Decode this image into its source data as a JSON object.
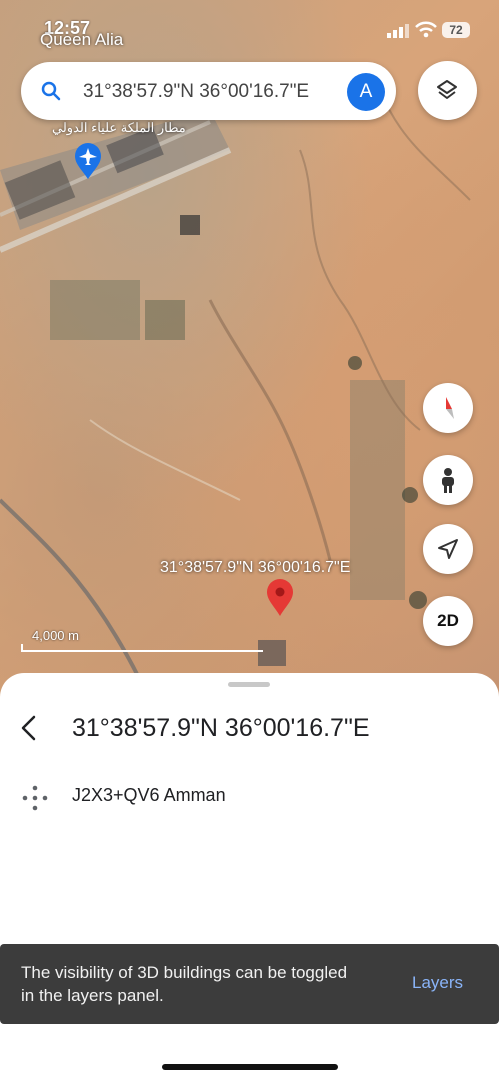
{
  "status_bar": {
    "time": "12:57",
    "battery": "72"
  },
  "map": {
    "place_labels": {
      "queen_alia": "Queen Alia",
      "arabic_airport": "مطار الملكة علياء الدولي"
    },
    "coordinate_label": "31°38'57.9\"N 36°00'16.7\"E",
    "scale_label": "4,000 m",
    "mode_button": "2D",
    "colors": {
      "pin_red": "#e53935",
      "airport_pin_blue": "#1a73e8"
    }
  },
  "search": {
    "value": "31°38'57.9\"N 36°00'16.7\"E",
    "avatar_letter": "A"
  },
  "sheet": {
    "title": "31°38'57.9\"N 36°00'16.7\"E",
    "plus_code": "J2X3+QV6 Amman"
  },
  "snackbar": {
    "message": "The visibility of 3D buildings can be toggled in the layers panel.",
    "action": "Layers"
  },
  "icons": [
    "search-icon",
    "layers-icon",
    "compass-icon",
    "pegman-icon",
    "navigation-arrow-icon",
    "airport-icon",
    "map-pin-icon",
    "back-arrow-icon",
    "plus-code-icon",
    "signal-icon",
    "wifi-icon"
  ]
}
